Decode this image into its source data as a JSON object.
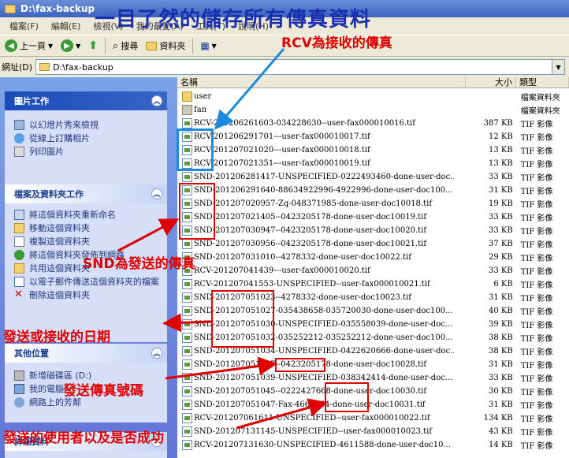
{
  "window": {
    "title": "D:\\fax-backup"
  },
  "menu": [
    "檔案(F)",
    "編輯(E)",
    "檢視(V)",
    "我的最愛(A)",
    "工具(T)",
    "說明(H)"
  ],
  "toolbar": {
    "back": "上一頁",
    "search": "搜尋",
    "folders": "資料夾"
  },
  "address": {
    "label": "網址(D)",
    "path": "D:\\fax-backup"
  },
  "sidebar": {
    "picture_tasks": {
      "title": "圖片工作",
      "items": [
        "以幻燈片秀來檢視",
        "從線上訂購相片",
        "列印圖片"
      ]
    },
    "file_tasks": {
      "title": "檔案及資料夾工作",
      "items": [
        "將這個資料夾重新命名",
        "移動這個資料夾",
        "複製這個資料夾",
        "將這個資料夾發佈到網路",
        "共用這個資料夾",
        "以電子郵件傳送這個資料夾的檔案",
        "刪除這個資料夾"
      ]
    },
    "other_places": {
      "title": "其他位置",
      "items": [
        "新增磁碟區 (D:)",
        "我的電腦",
        "網路上的芳鄰"
      ]
    },
    "details": {
      "title": "詳細資料"
    }
  },
  "columns": {
    "name": "名稱",
    "size": "大小",
    "type": "類型"
  },
  "files": [
    {
      "name": "user",
      "size": "",
      "type": "檔案資料夾",
      "kind": "folder"
    },
    {
      "name": "fan",
      "size": "",
      "type": "檔案資料夾",
      "kind": "folder"
    },
    {
      "name": "RCV-201206261603-034228630--user-fax000010016.tif",
      "size": "387 KB",
      "type": "TIF 影像",
      "kind": "tif"
    },
    {
      "name": "RCV-201206291701---user-fax000010017.tif",
      "size": "12 KB",
      "type": "TIF 影像",
      "kind": "tif"
    },
    {
      "name": "RCV-201207021020---user-fax000010018.tif",
      "size": "13 KB",
      "type": "TIF 影像",
      "kind": "tif"
    },
    {
      "name": "RCV-201207021351---user-fax000010019.tif",
      "size": "13 KB",
      "type": "TIF 影像",
      "kind": "tif"
    },
    {
      "name": "SND-201206281417-UNSPECIFIED-0222493460-done-user-doc...",
      "size": "33 KB",
      "type": "TIF 影像",
      "kind": "tif"
    },
    {
      "name": "SND-201206291640-88634922996-4922996-done-user-doc100...",
      "size": "31 KB",
      "type": "TIF 影像",
      "kind": "tif"
    },
    {
      "name": "SND-201207020957-Zq-048371985-done-user-doc10018.tif",
      "size": "19 KB",
      "type": "TIF 影像",
      "kind": "tif"
    },
    {
      "name": "SND-201207021405--0423205178-done-user-doc10019.tif",
      "size": "33 KB",
      "type": "TIF 影像",
      "kind": "tif"
    },
    {
      "name": "SND-201207030947--0423205178-done-user-doc10020.tif",
      "size": "33 KB",
      "type": "TIF 影像",
      "kind": "tif"
    },
    {
      "name": "SND-201207030956--0423205178-done-user-doc10021.tif",
      "size": "37 KB",
      "type": "TIF 影像",
      "kind": "tif"
    },
    {
      "name": "SND-201207031010--4278332-done-user-doc10022.tif",
      "size": "29 KB",
      "type": "TIF 影像",
      "kind": "tif"
    },
    {
      "name": "RCV-201207041439---user-fax000010020.tif",
      "size": "33 KB",
      "type": "TIF 影像",
      "kind": "tif"
    },
    {
      "name": "RCV-201207041553-UNSPECIFIED--user-fax000010021.tif",
      "size": "6 KB",
      "type": "TIF 影像",
      "kind": "tif"
    },
    {
      "name": "SND-201207051023--4278332-done-user-doc10023.tif",
      "size": "31 KB",
      "type": "TIF 影像",
      "kind": "tif"
    },
    {
      "name": "SND-201207051027-035438658-035720030-done-user-doc100...",
      "size": "40 KB",
      "type": "TIF 影像",
      "kind": "tif"
    },
    {
      "name": "SND-201207051030-UNSPECIFIED-035558039-done-user-doc...",
      "size": "39 KB",
      "type": "TIF 影像",
      "kind": "tif"
    },
    {
      "name": "SND-201207051032-035252212-035252212-done-user-doc100...",
      "size": "38 KB",
      "type": "TIF 影像",
      "kind": "tif"
    },
    {
      "name": "SND-201207051034-UNSPECIFIED-0422620666-done-user-doc...",
      "size": "38 KB",
      "type": "TIF 影像",
      "kind": "tif"
    },
    {
      "name": "SND-201207051037--0423205178-done-user-doc10028.tif",
      "size": "31 KB",
      "type": "TIF 影像",
      "kind": "tif"
    },
    {
      "name": "SND-201207051039-UNSPECIFIED-038342414-done-user-doc...",
      "size": "33 KB",
      "type": "TIF 影像",
      "kind": "tif"
    },
    {
      "name": "SND-201207051045--0222427668-done-user-doc10030.tif",
      "size": "30 KB",
      "type": "TIF 影像",
      "kind": "tif"
    },
    {
      "name": "SND-201207051047-Fax-4663364-done-user-doc10031.tif",
      "size": "31 KB",
      "type": "TIF 影像",
      "kind": "tif"
    },
    {
      "name": "RCV-201207061611-UNSPECIFIED--user-fax000010022.tif",
      "size": "134 KB",
      "type": "TIF 影像",
      "kind": "tif"
    },
    {
      "name": "SND-201207131145-UNSPECIFIED--user-fax000010023.tif",
      "size": "43 KB",
      "type": "TIF 影像",
      "kind": "tif"
    },
    {
      "name": "RCV-201207131630-UNSPECIFIED-4611588-done-user-doc10...",
      "size": "14 KB",
      "type": "TIF 影像",
      "kind": "tif"
    }
  ],
  "annotations": {
    "headline": "一目了然的儲存所有傳真資料",
    "rcv": "RCV為接收的傳真",
    "snd": "SND為發送的傳真",
    "date": "發送或接收的日期",
    "number": "發送傳真號碼",
    "status": "發送的使用者以及是否成功"
  },
  "colors": {
    "annotation": "#e00000",
    "headline": "#1a2fb0",
    "rcv_box": "#1a8be0"
  }
}
